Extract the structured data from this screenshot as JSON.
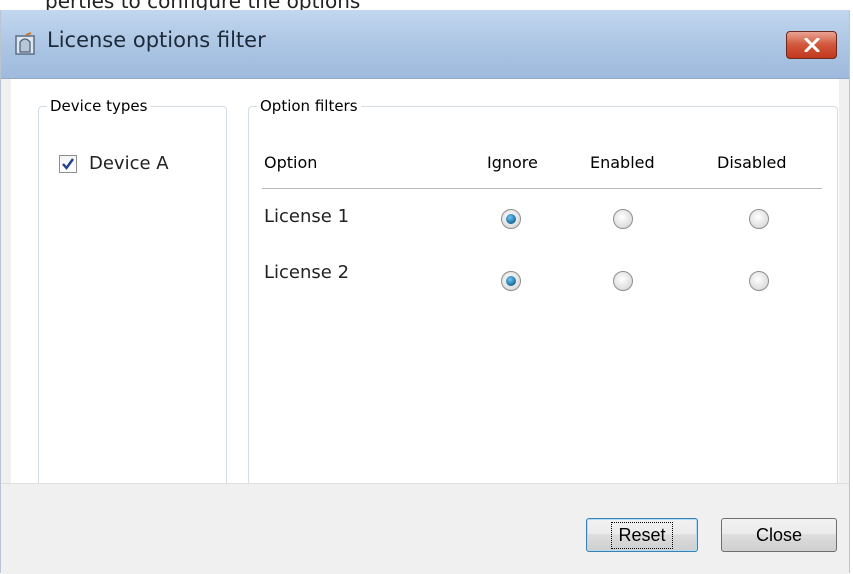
{
  "background_text": "perties to configure the options",
  "window": {
    "title": "License options filter"
  },
  "device_types": {
    "legend": "Device types",
    "devices": [
      {
        "label": "Device A",
        "checked": true
      }
    ]
  },
  "option_filters": {
    "legend": "Option filters",
    "columns": [
      "Option",
      "Ignore",
      "Enabled",
      "Disabled"
    ],
    "rows": [
      {
        "label": "License 1",
        "selected": "Ignore"
      },
      {
        "label": "License 2",
        "selected": "Ignore"
      }
    ]
  },
  "buttons": {
    "reset": "Reset",
    "close": "Close"
  },
  "colors": {
    "titlebar": "#a9c3e2",
    "close_button": "#c2391e",
    "radio_selected": "#176a9e"
  }
}
